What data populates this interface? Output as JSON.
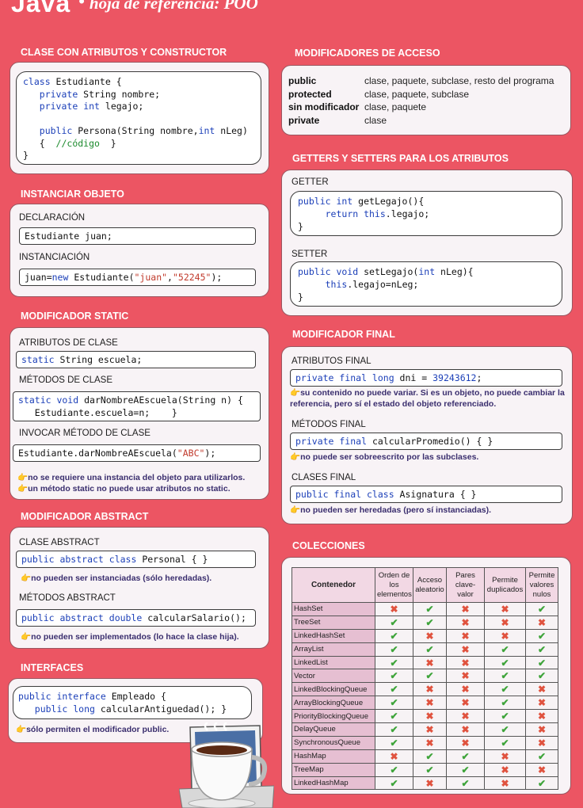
{
  "header": {
    "title": "Java",
    "bullet": "•",
    "subtitle": "hoja de referencia: POO"
  },
  "sections": {
    "clase": "CLASE CON ATRIBUTOS Y CONSTRUCTOR",
    "instanciar": "INSTANCIAR OBJETO",
    "static": "MODIFICADOR STATIC",
    "abstract": "MODIFICADOR ABSTRACT",
    "interfaces": "INTERFACES",
    "acceso": "MODIFICADORES DE ACCESO",
    "getset": "GETTERS Y SETTERS PARA LOS ATRIBUTOS",
    "final": "MODIFICADOR FINAL",
    "colecciones": "COLECCIONES"
  },
  "labels": {
    "declaracion": "DECLARACIÓN",
    "instanciacion": "INSTANCIACIÓN",
    "atributos_clase": "ATRIBUTOS DE CLASE",
    "metodos_clase": "MÉTODOS DE CLASE",
    "invocar": "INVOCAR MÉTODO DE CLASE",
    "clase_abstract": "CLASE ABSTRACT",
    "metodos_abstract": "MÉTODOS ABSTRACT",
    "getter": "GETTER",
    "setter": "SETTER",
    "atributos_final": "ATRIBUTOS FINAL",
    "metodos_final": "MÉTODOS FINAL",
    "clases_final": "CLASES FINAL"
  },
  "notes": {
    "static1": "no se requiere una instancia del objeto para utilizarlos.",
    "static2": "un método static no puede usar atributos no static.",
    "abstract1": "no pueden ser instanciadas (sólo heredadas).",
    "abstract2": "no pueden ser implementados (lo hace la clase hija).",
    "interfaces": "sólo permiten el modificador public.",
    "final1": "su contenido no puede variar. Si es un objeto, no puede cambiar la referencia, pero sí el estado del objeto referenciado.",
    "final2": "no puede ser sobreescrito por las subclases.",
    "final3": "no pueden ser heredadas (pero sí instanciadas)."
  },
  "acceso": [
    {
      "mod": "public",
      "desc": "clase, paquete, subclase, resto del programa"
    },
    {
      "mod": "protected",
      "desc": "clase, paquete, subclase"
    },
    {
      "mod": "sin modificador",
      "desc": "clase, paquete"
    },
    {
      "mod": "private",
      "desc": "clase"
    }
  ],
  "colecciones": {
    "headers": [
      "Contenedor",
      "Orden de los elementos",
      "Acceso aleatorio",
      "Pares clave-valor",
      "Permite duplicados",
      "Permite valores nulos"
    ],
    "rows": [
      {
        "name": "HashSet",
        "v": [
          0,
          1,
          0,
          0,
          1
        ]
      },
      {
        "name": "TreeSet",
        "v": [
          1,
          1,
          0,
          0,
          0
        ]
      },
      {
        "name": "LinkedHashSet",
        "v": [
          1,
          0,
          0,
          0,
          1
        ]
      },
      {
        "name": "ArrayList",
        "v": [
          1,
          1,
          0,
          1,
          1
        ]
      },
      {
        "name": "LinkedList",
        "v": [
          1,
          0,
          0,
          1,
          1
        ]
      },
      {
        "name": "Vector",
        "v": [
          1,
          1,
          0,
          1,
          1
        ]
      },
      {
        "name": "LinkedBlockingQueue",
        "v": [
          1,
          0,
          0,
          1,
          0
        ]
      },
      {
        "name": "ArrayBlockingQueue",
        "v": [
          1,
          0,
          0,
          1,
          0
        ]
      },
      {
        "name": "PriorityBlockingQueue",
        "v": [
          1,
          0,
          0,
          1,
          0
        ]
      },
      {
        "name": "DelayQueue",
        "v": [
          1,
          0,
          0,
          1,
          0
        ]
      },
      {
        "name": "SynchronousQueue",
        "v": [
          1,
          0,
          0,
          1,
          0
        ]
      },
      {
        "name": "HashMap",
        "v": [
          0,
          1,
          1,
          0,
          1
        ]
      },
      {
        "name": "TreeMap",
        "v": [
          1,
          1,
          1,
          0,
          0
        ]
      },
      {
        "name": "LinkedHashMap",
        "v": [
          1,
          0,
          1,
          0,
          1
        ]
      }
    ]
  },
  "icons": {
    "yes": "✔",
    "no": "✖",
    "hand": "👉"
  }
}
